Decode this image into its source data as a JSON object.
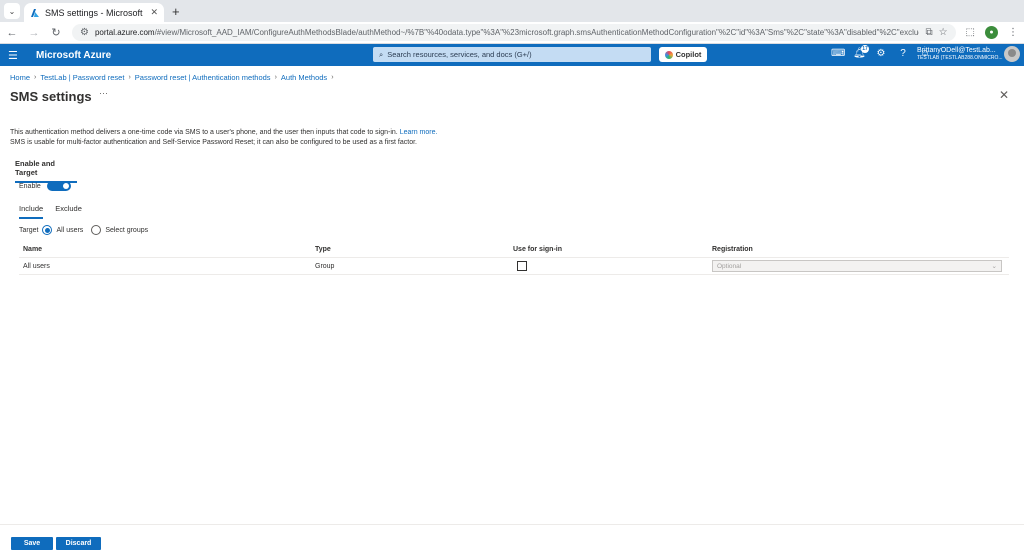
{
  "browser": {
    "tab_title": "SMS settings - Microsoft",
    "url_host": "portal.azure.com",
    "url_rest": "/#view/Microsoft_AAD_IAM/ConfigureAuthMethodsBlade/authMethod~/%7B\"%40odata.type\"%3A\"%23microsoft.graph.smsAuthenticationMethodConfiguration\"%2C\"id\"%3A\"Sms\"%2C\"state\"%3A\"disabled\"%2C\"excludeTarget..."
  },
  "azure": {
    "brand": "Microsoft Azure",
    "search_placeholder": "Search resources, services, and docs (G+/)",
    "copilot_label": "Copilot",
    "notification_count": "17",
    "account_name": "BrittanyODell@TestLab...",
    "account_tenant": "TESTLAB (TESTLAB288.ONMICRO..."
  },
  "breadcrumb": [
    "Home",
    "TestLab | Password reset",
    "Password reset | Authentication methods",
    "Auth Methods"
  ],
  "page": {
    "title": "SMS settings",
    "description_line1": "This authentication method delivers a one-time code via SMS to a user's phone, and the user then inputs that code to sign-in.",
    "learn_more": "Learn more.",
    "description_line2": "SMS is usable for multi-factor authentication and Self-Service Password Reset; it can also be configured to be used as a first factor.",
    "section_tab": "Enable and Target",
    "enable_label": "Enable",
    "subtabs": [
      "Include",
      "Exclude"
    ],
    "target_label": "Target",
    "target_options": [
      "All users",
      "Select groups"
    ]
  },
  "grid": {
    "headers": [
      "Name",
      "Type",
      "Use for sign-in",
      "Registration"
    ],
    "rows": [
      {
        "name": "All users",
        "type": "Group",
        "registration": "Optional"
      }
    ]
  },
  "footer": {
    "save_label": "Save",
    "discard_label": "Discard"
  },
  "colors": {
    "accent": "#0f6cbd"
  }
}
